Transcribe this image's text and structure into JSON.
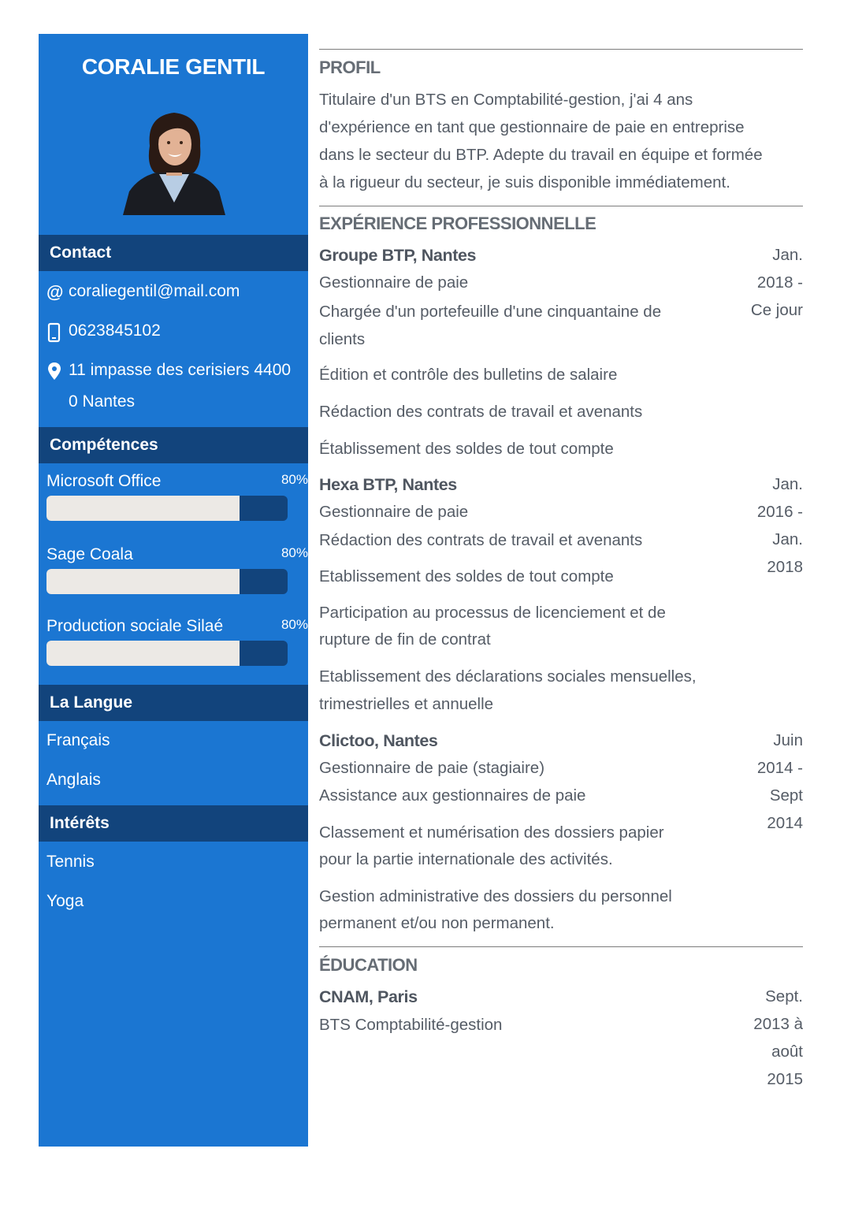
{
  "sidebar": {
    "name": "CORALIE GENTIL",
    "contact": {
      "title": "Contact",
      "email": "coraliegentil@mail.com",
      "phone": "0623845102",
      "address_line1": "11 impasse des cerisiers 4400",
      "address_line2": "0 Nantes"
    },
    "skills": {
      "title": "Compétences",
      "items": [
        {
          "name": "Microsoft Office",
          "percent_label": "80%",
          "level": 0.8
        },
        {
          "name": "Sage Coala",
          "percent_label": "80%",
          "level": 0.8
        },
        {
          "name": "Production sociale Silaé",
          "percent_label": "80%",
          "level": 0.8
        }
      ]
    },
    "languages": {
      "title": "La Langue",
      "items": [
        "Français",
        "Anglais"
      ]
    },
    "interests": {
      "title": "Intérêts",
      "items": [
        "Tennis",
        "Yoga"
      ]
    }
  },
  "main": {
    "profile": {
      "title": "PROFIL",
      "lines": [
        "Titulaire d'un BTS en Comptabilité-gestion, j'ai 4 ans",
        "d'expérience en tant que gestionnaire de paie en entreprise",
        "dans le secteur du BTP. Adepte du travail en équipe et formée",
        "à la rigueur du secteur, je suis disponible immédiatement."
      ]
    },
    "experience": {
      "title": "EXPÉRIENCE PROFESSIONNELLE",
      "jobs": [
        {
          "company": "Groupe BTP, Nantes",
          "date_lines": [
            "Jan.",
            "2018 -",
            "Ce jour"
          ],
          "lines": [
            "Gestionnaire de paie",
            "Chargée d'un portefeuille d'une cinquantaine de",
            "clients",
            "Édition et contrôle des bulletins de salaire",
            "Rédaction des contrats de travail et avenants",
            "Établissement des soldes de tout compte"
          ]
        },
        {
          "company": "Hexa BTP, Nantes",
          "date_lines": [
            "Jan.",
            "2016 -",
            "Jan.",
            "2018"
          ],
          "lines": [
            "Gestionnaire de paie",
            "Rédaction des contrats de travail et avenants",
            "Etablissement des soldes de tout compte",
            "Participation au processus de licenciement et de",
            "rupture de fin de contrat",
            "Etablissement des déclarations sociales mensuelles,",
            "trimestrielles et annuelle"
          ]
        },
        {
          "company": "Clictoo, Nantes",
          "date_lines": [
            "Juin",
            "2014 -",
            "Sept",
            "2014"
          ],
          "lines": [
            "Gestionnaire de paie (stagiaire)",
            "Assistance aux gestionnaires de paie",
            "Classement et numérisation des dossiers papier",
            "pour la partie internationale des activités.",
            "Gestion administrative des dossiers du personnel",
            "permanent et/ou non permanent."
          ]
        }
      ]
    },
    "education": {
      "title": "ÉDUCATION",
      "items": [
        {
          "school": "CNAM, Paris",
          "degree": "BTS Comptabilité-gestion",
          "date_lines": [
            "Sept.",
            "2013 à",
            "août",
            "2015"
          ]
        }
      ]
    }
  },
  "colors": {
    "sidebar_bg": "#1b76d2",
    "section_header_bg": "#12447c",
    "skill_bar_fill": "#ece9e5",
    "body_text": "#555c66"
  }
}
